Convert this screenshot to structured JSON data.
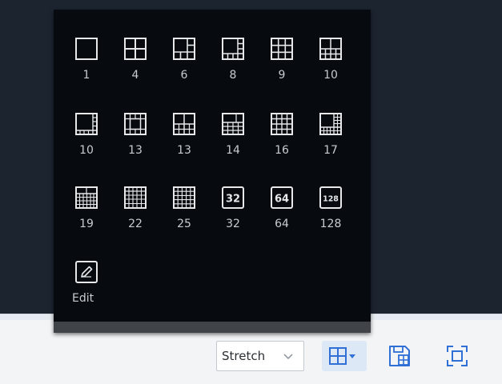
{
  "layout_menu": {
    "items": [
      {
        "label": "1",
        "icon": "layout-1-icon"
      },
      {
        "label": "4",
        "icon": "layout-4-icon"
      },
      {
        "label": "6",
        "icon": "layout-6-icon"
      },
      {
        "label": "8",
        "icon": "layout-8-icon"
      },
      {
        "label": "9",
        "icon": "layout-9-icon"
      },
      {
        "label": "10",
        "icon": "layout-10-icon"
      },
      {
        "label": "10",
        "icon": "layout-10b-icon"
      },
      {
        "label": "13",
        "icon": "layout-13-icon"
      },
      {
        "label": "13",
        "icon": "layout-13b-icon"
      },
      {
        "label": "14",
        "icon": "layout-14-icon"
      },
      {
        "label": "16",
        "icon": "layout-16-icon"
      },
      {
        "label": "17",
        "icon": "layout-17-icon"
      },
      {
        "label": "19",
        "icon": "layout-19-icon"
      },
      {
        "label": "22",
        "icon": "layout-22-icon"
      },
      {
        "label": "25",
        "icon": "layout-25-icon"
      },
      {
        "label": "32",
        "icon": "layout-32-icon",
        "badge": "32"
      },
      {
        "label": "64",
        "icon": "layout-64-icon",
        "badge": "64"
      },
      {
        "label": "128",
        "icon": "layout-128-icon",
        "badge": "128"
      }
    ],
    "edit": {
      "label": "Edit",
      "icon": "pencil-edit-icon"
    }
  },
  "toolbar": {
    "stretch_value": "Stretch",
    "layout_icon": "grid-layout-icon",
    "save_icon": "save-layout-icon",
    "fullscreen_icon": "fullscreen-icon"
  },
  "colors": {
    "popup_bg": "#070b0f",
    "video_bg": "#1c2430",
    "icon_stroke": "#e6e8ea",
    "toolbar_icon": "#2f6fd6",
    "active_button_bg": "#dce8f6"
  }
}
